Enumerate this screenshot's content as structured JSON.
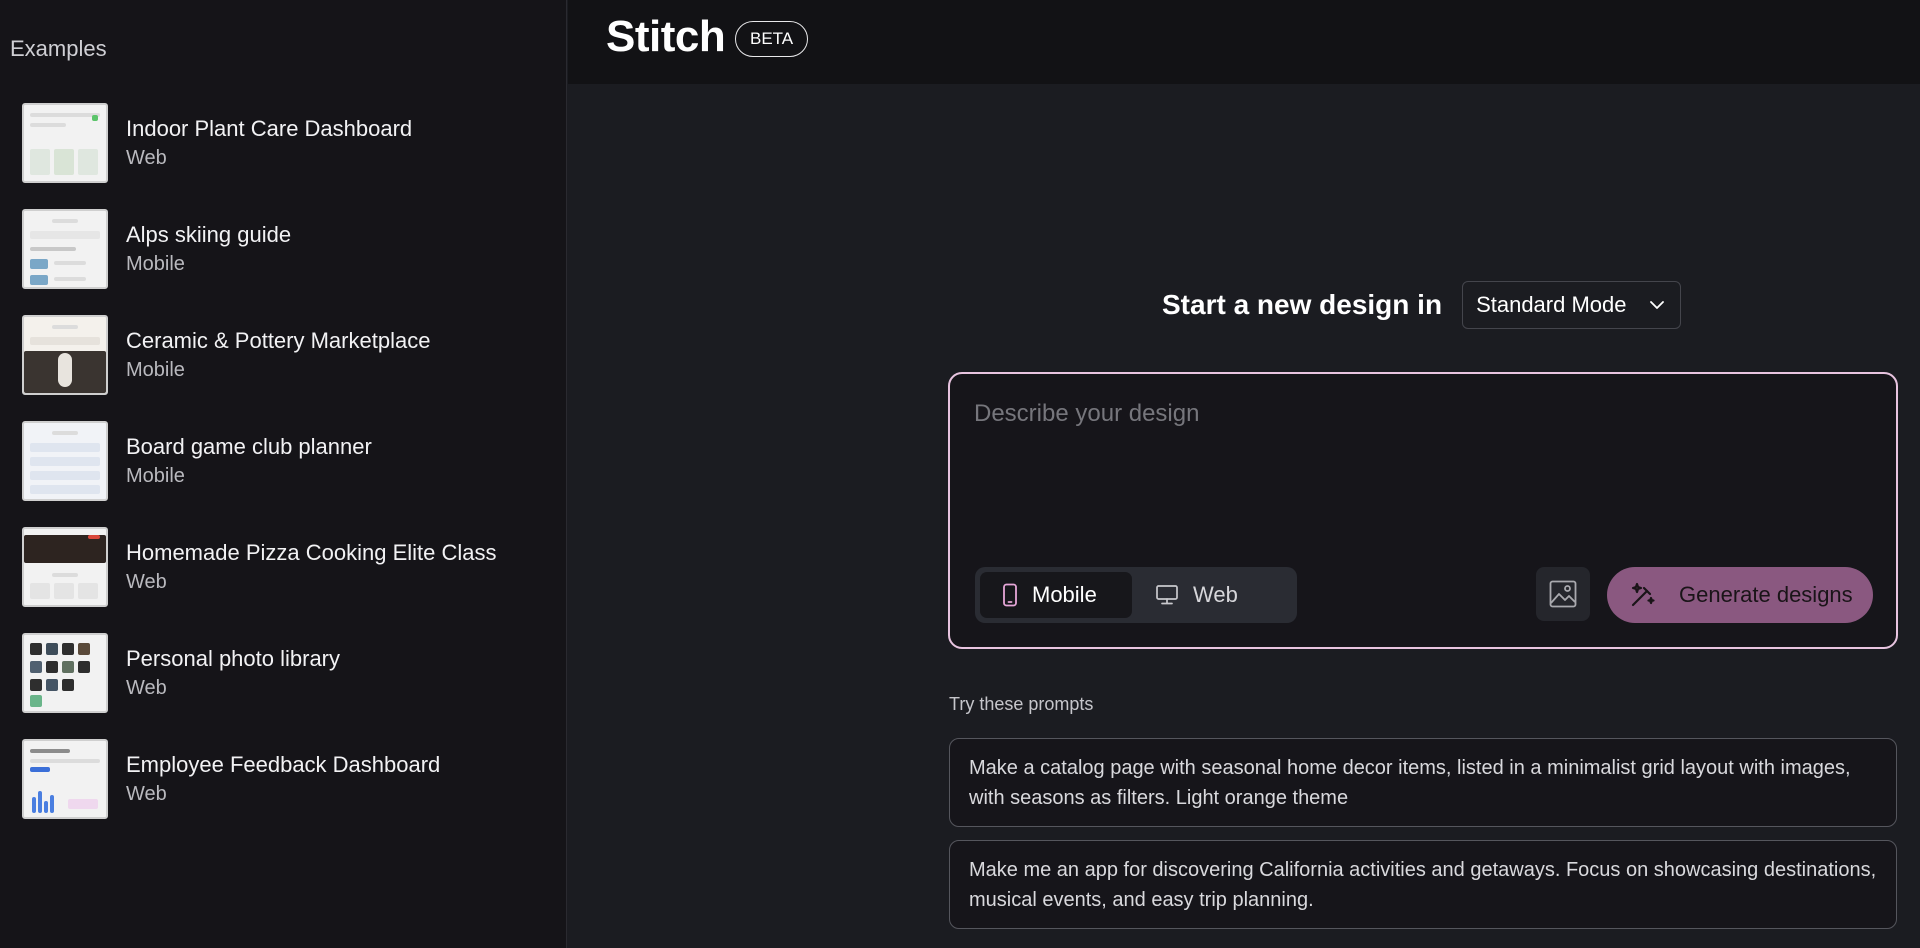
{
  "sidebar": {
    "title": "Examples",
    "items": [
      {
        "title": "Indoor Plant Care Dashboard",
        "type": "Web"
      },
      {
        "title": "Alps skiing guide",
        "type": "Mobile"
      },
      {
        "title": "Ceramic & Pottery Marketplace",
        "type": "Mobile"
      },
      {
        "title": "Board game club planner",
        "type": "Mobile"
      },
      {
        "title": "Homemade Pizza Cooking Elite Class",
        "type": "Web"
      },
      {
        "title": "Personal photo library",
        "type": "Web"
      },
      {
        "title": "Employee Feedback Dashboard",
        "type": "Web"
      }
    ]
  },
  "header": {
    "brand": "Stitch",
    "badge": "BETA"
  },
  "main": {
    "start_label": "Start a new design in",
    "mode": "Standard Mode",
    "prompt_placeholder": "Describe your design",
    "toggle": {
      "mobile": "Mobile",
      "web": "Web",
      "selected": "Mobile"
    },
    "generate_label": "Generate designs",
    "try_label": "Try these prompts",
    "suggestions": [
      "Make a catalog page with seasonal home decor items, listed in a minimalist grid layout with images, with seasons as filters. Light orange theme",
      "Make me an app for discovering California activities and getaways. Focus on showcasing destinations, musical events, and easy trip planning."
    ]
  },
  "colors": {
    "accent_border": "#e8c4e0",
    "generate_bg": "#8a5880",
    "mobile_icon": "#e6a6d8"
  },
  "icons": {
    "mode_chevron": "chevron-down-icon",
    "mobile": "phone-icon",
    "web": "monitor-icon",
    "image": "image-icon",
    "generate": "magic-wand-icon"
  }
}
